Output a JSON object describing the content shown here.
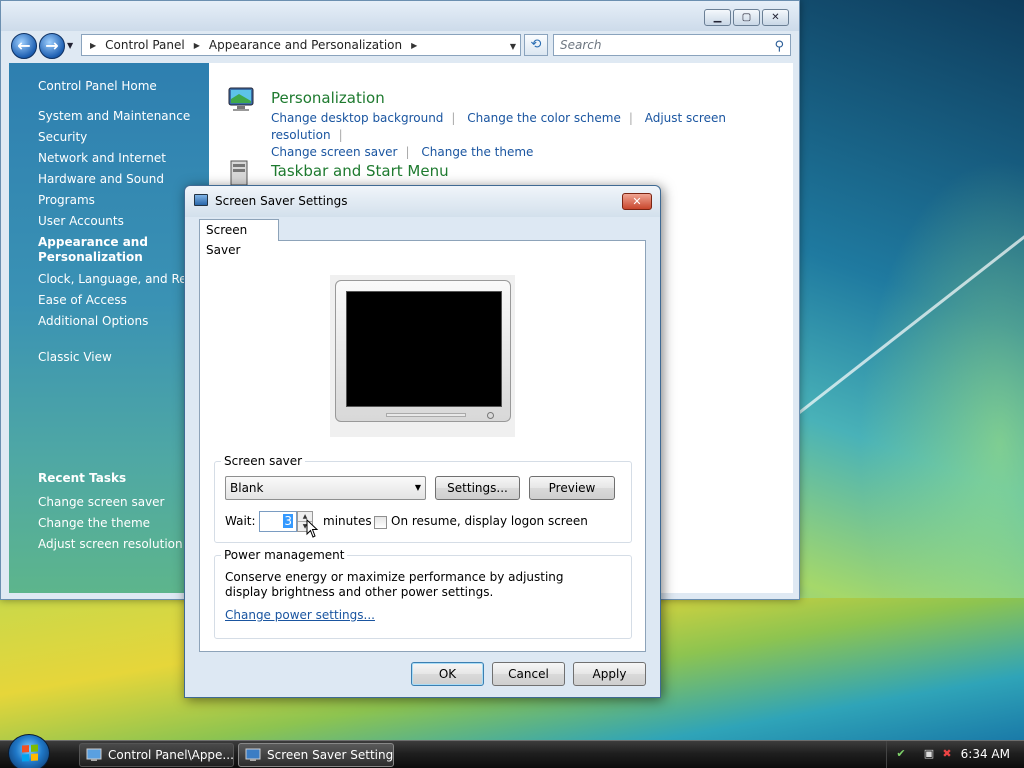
{
  "control_panel": {
    "address": {
      "crumbs": [
        "Control Panel",
        "Appearance and Personalization"
      ]
    },
    "search_placeholder": "Search",
    "sidebar": {
      "home": "Control Panel Home",
      "items": [
        {
          "label": "System and Maintenance"
        },
        {
          "label": "Security"
        },
        {
          "label": "Network and Internet"
        },
        {
          "label": "Hardware and Sound"
        },
        {
          "label": "Programs"
        },
        {
          "label": "User Accounts"
        },
        {
          "label": "Appearance and Personalization"
        },
        {
          "label": "Clock, Language, and Region"
        },
        {
          "label": "Ease of Access"
        },
        {
          "label": "Additional Options"
        }
      ],
      "classic_view": "Classic View",
      "recent_tasks_title": "Recent Tasks",
      "recent_tasks": [
        {
          "label": "Change screen saver"
        },
        {
          "label": "Change the theme"
        },
        {
          "label": "Adjust screen resolution"
        }
      ]
    },
    "categories": [
      {
        "title": "Personalization",
        "links": [
          "Change desktop background",
          "Change the color scheme",
          "Adjust screen resolution",
          "Change screen saver",
          "Change the theme"
        ]
      },
      {
        "title": "Taskbar and Start Menu"
      }
    ]
  },
  "dialog": {
    "title": "Screen Saver Settings",
    "tab": "Screen Saver",
    "screen_saver_group": "Screen saver",
    "selected_saver": "Blank",
    "settings_button": "Settings...",
    "preview_button": "Preview",
    "wait_label": "Wait:",
    "wait_value": "3",
    "minutes_label": "minutes",
    "resume_checkbox_label": "On resume, display logon screen",
    "resume_checked": false,
    "power_group": "Power management",
    "power_text": "Conserve energy or maximize performance by adjusting display brightness and other power settings.",
    "power_link": "Change power settings...",
    "ok_button": "OK",
    "cancel_button": "Cancel",
    "apply_button": "Apply"
  },
  "taskbar": {
    "buttons": [
      {
        "label": "Control Panel\\Appe..."
      },
      {
        "label": "Screen Saver Settings"
      }
    ],
    "clock": "6:34 AM"
  }
}
